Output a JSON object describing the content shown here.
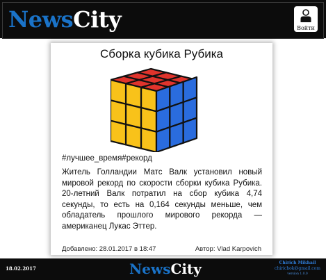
{
  "header": {
    "logo_news": "News",
    "logo_city": "City",
    "login_label": "Войти",
    "login_icon": "user-icon"
  },
  "article": {
    "title": "Сборка кубика Рубика",
    "image_icon": "rubiks-cube-image",
    "tags": "#лучшее_время#рекорд",
    "body": "Житель Голландии Матс Валк установил новый мировой рекорд по скорости сборки кубика Рубика. 20-летний Валк потратил на сбор кубика 4,74 секунды, то есть на 0,164 секунды меньше, чем обладатель прошлого мирового рекорда — американец Лукас Эттер.",
    "added": "Добавлено: 28.01.2017 в 18:47",
    "author": "Автор: Vlad Karpovich"
  },
  "footer": {
    "date": "18.02.2017",
    "logo_news": "News",
    "logo_city": "City",
    "contact_name": "Chirich Mikhail",
    "contact_email": "chirichok@gmail.com",
    "contact_version": "version 1.0.0"
  },
  "colors": {
    "brand_blue": "#1a73c8",
    "header_bg": "#0c0c0c",
    "cube_red": "#e0342c",
    "cube_yellow": "#f8c21a",
    "cube_blue": "#2a6cde"
  }
}
